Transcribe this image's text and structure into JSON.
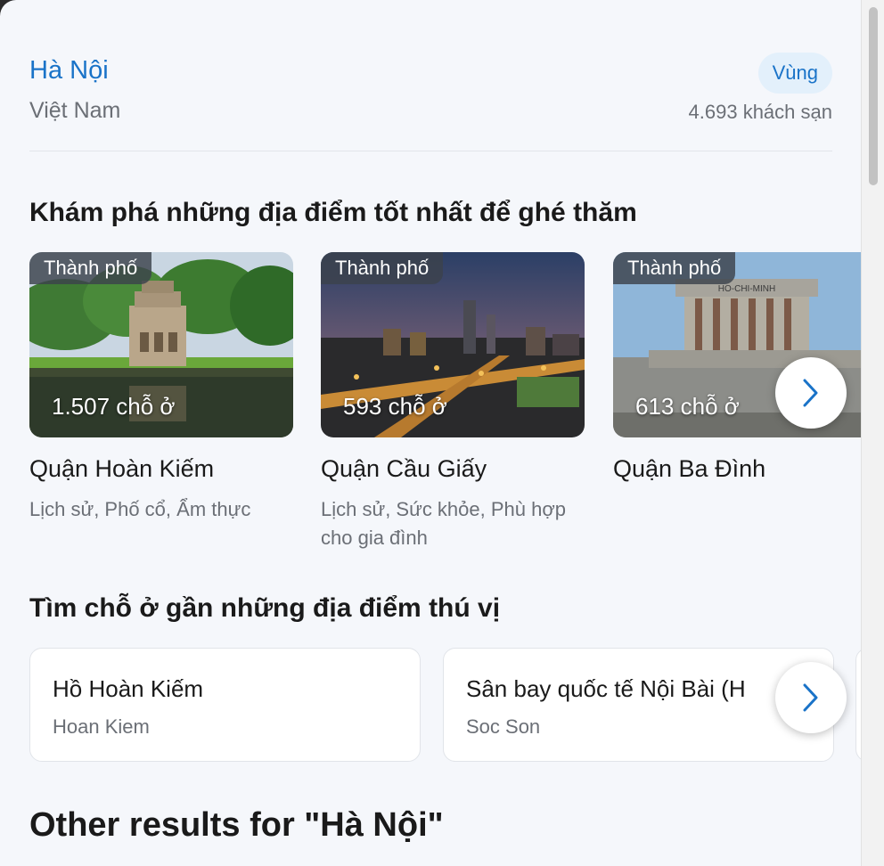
{
  "region": {
    "name": "Hà Nội",
    "country": "Việt Nam",
    "badge": "Vùng",
    "hotel_count": "4.693 khách sạn"
  },
  "explore": {
    "title": "Khám phá những địa điểm tốt nhất để ghé thăm",
    "cards": [
      {
        "tag": "Thành phố",
        "count": "1.507 chỗ ở",
        "name": "Quận Hoàn Kiếm",
        "desc": "Lịch sử, Phố cổ, Ẩm thực"
      },
      {
        "tag": "Thành phố",
        "count": "593 chỗ ở",
        "name": "Quận Cầu Giấy",
        "desc": "Lịch sử, Sức khỏe, Phù hợp cho gia đình"
      },
      {
        "tag": "Thành phố",
        "count": "613 chỗ ở",
        "name": "Quận Ba Đình",
        "desc": ""
      }
    ],
    "sign_text": "HO-CHI-MINH"
  },
  "nearby": {
    "title": "Tìm chỗ ở gần những địa điểm thú vị",
    "places": [
      {
        "name": "Hồ Hoàn Kiếm",
        "area": "Hoan Kiem"
      },
      {
        "name": "Sân bay quốc tế Nội Bài (H",
        "area": "Soc Son"
      }
    ]
  },
  "other_results": {
    "title": "Other results for \"Hà Nội\""
  },
  "icons": {
    "next": "chevron-right-icon"
  },
  "colors": {
    "accent": "#1a73c8",
    "muted": "#6b6f76",
    "background": "#f5f7fb"
  }
}
